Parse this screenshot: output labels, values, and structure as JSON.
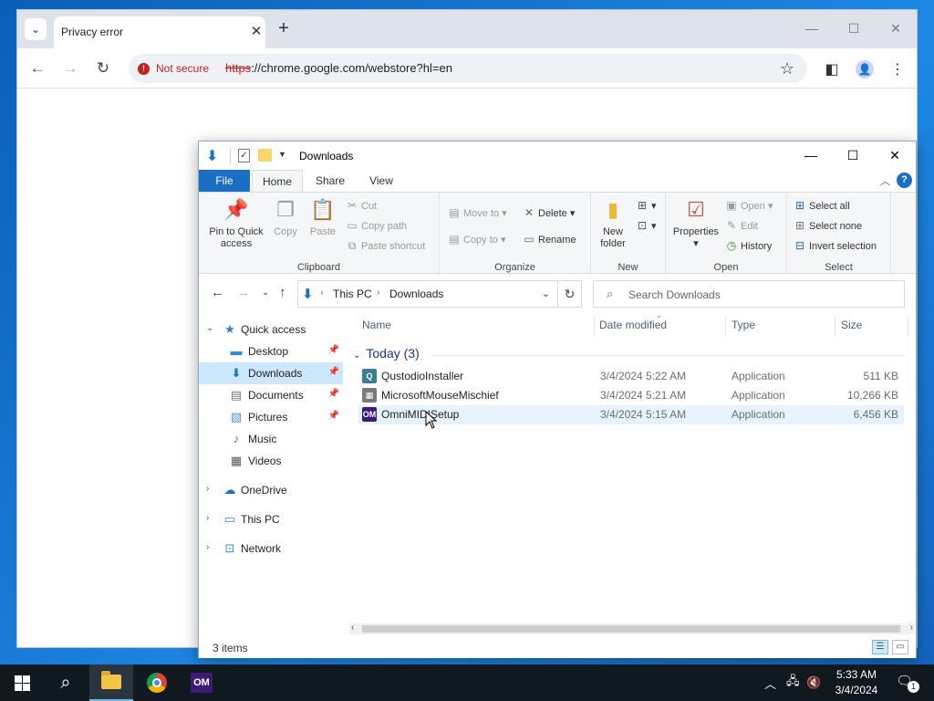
{
  "chrome": {
    "tab_title": "Privacy error",
    "security_label": "Not secure",
    "url_scheme": "https",
    "url_rest": "://chrome.google.com/webstore?hl=en"
  },
  "explorer": {
    "title": "Downloads",
    "ribbon_tabs": {
      "file": "File",
      "home": "Home",
      "share": "Share",
      "view": "View"
    },
    "clipboard": {
      "label": "Clipboard",
      "pin_line1": "Pin to Quick",
      "pin_line2": "access",
      "copy": "Copy",
      "paste": "Paste",
      "cut": "Cut",
      "copy_path": "Copy path",
      "paste_shortcut": "Paste shortcut"
    },
    "organize": {
      "label": "Organize",
      "move_to": "Move to",
      "copy_to": "Copy to",
      "delete": "Delete",
      "rename": "Rename"
    },
    "new_group": {
      "label": "New",
      "new_line1": "New",
      "new_line2": "folder"
    },
    "open_group": {
      "label": "Open",
      "properties": "Properties",
      "open": "Open",
      "edit": "Edit",
      "history": "History"
    },
    "select_group": {
      "label": "Select",
      "select_all": "Select all",
      "select_none": "Select none",
      "invert": "Invert selection"
    },
    "address": {
      "this_pc": "This PC",
      "downloads": "Downloads"
    },
    "search_placeholder": "Search Downloads",
    "nav": {
      "quick_access": "Quick access",
      "desktop": "Desktop",
      "downloads": "Downloads",
      "documents": "Documents",
      "pictures": "Pictures",
      "music": "Music",
      "videos": "Videos",
      "onedrive": "OneDrive",
      "this_pc": "This PC",
      "network": "Network"
    },
    "columns": {
      "name": "Name",
      "date": "Date modified",
      "type": "Type",
      "size": "Size"
    },
    "group": "Today (3)",
    "files": [
      {
        "name": "QustodioInstaller",
        "date": "3/4/2024 5:22 AM",
        "type": "Application",
        "size": "511 KB"
      },
      {
        "name": "MicrosoftMouseMischief",
        "date": "3/4/2024 5:21 AM",
        "type": "Application",
        "size": "10,266 KB"
      },
      {
        "name": "OmniMIDISetup",
        "date": "3/4/2024 5:15 AM",
        "type": "Application",
        "size": "6,456 KB"
      }
    ],
    "status": "3 items"
  },
  "taskbar": {
    "om_label": "OM",
    "time": "5:33 AM",
    "date": "3/4/2024",
    "notification_count": "1"
  },
  "colors": {
    "accent": "#1a6fc5",
    "warning": "#c5221f",
    "selection": "#cce8ff"
  }
}
